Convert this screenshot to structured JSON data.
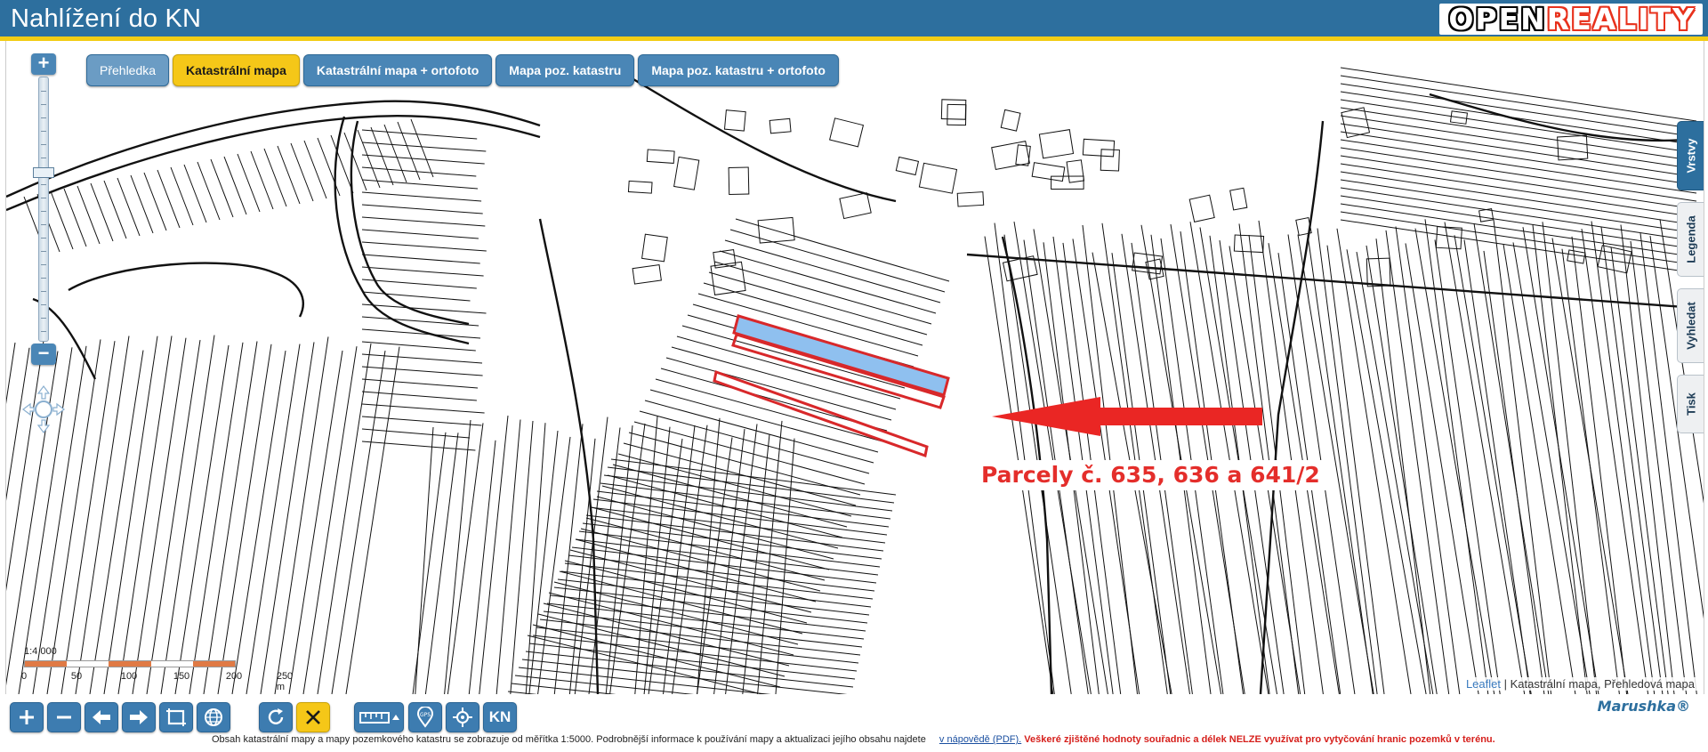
{
  "header": {
    "title": "Nahlížení do KN",
    "logo": {
      "open": "OPEN",
      "reality": "REALITY"
    }
  },
  "tabs": [
    {
      "label": "Přehledka",
      "state": "dim"
    },
    {
      "label": "Katastrální mapa",
      "state": "active"
    },
    {
      "label": "Katastrální mapa + ortofoto",
      "state": "normal"
    },
    {
      "label": "Mapa poz. katastru",
      "state": "normal"
    },
    {
      "label": "Mapa poz. katastru + ortofoto",
      "state": "normal"
    }
  ],
  "zoom": {
    "plus": "+",
    "minus": "−"
  },
  "side_tabs": [
    {
      "label": "Vrstvy",
      "active": true
    },
    {
      "label": "Legenda",
      "active": false
    },
    {
      "label": "Vyhledat",
      "active": false
    },
    {
      "label": "Tisk",
      "active": false
    }
  ],
  "scale": {
    "ratio": "1:4 000",
    "labels": [
      "0",
      "50",
      "100",
      "150",
      "200",
      "250 m"
    ],
    "colors": [
      "#e07a45",
      "#ffffff"
    ]
  },
  "annotation": {
    "label": "Parcely č. 635, 636 a 641/2",
    "color": "#e42e2b",
    "highlight_fill": "#8fc0ef"
  },
  "attribution": {
    "leaflet": "Leaflet",
    "separator": " | ",
    "text": "Katastrální mapa, Přehledová mapa"
  },
  "toolbar": {
    "buttons": [
      {
        "name": "zoom-in-button",
        "icon": "plus-icon"
      },
      {
        "name": "zoom-out-button",
        "icon": "minus-icon"
      },
      {
        "name": "back-button",
        "icon": "arrow-left-icon"
      },
      {
        "name": "forward-button",
        "icon": "arrow-right-icon"
      },
      {
        "name": "zoom-extent-button",
        "icon": "extent-icon"
      },
      {
        "name": "overview-button",
        "icon": "globe-icon"
      },
      {
        "name": "refresh-button",
        "icon": "refresh-icon"
      },
      {
        "name": "clear-button",
        "icon": "close-icon"
      },
      {
        "name": "measure-button",
        "icon": "ruler-icon"
      },
      {
        "name": "gps-button",
        "icon": "gps-pin-icon"
      },
      {
        "name": "locate-button",
        "icon": "crosshair-icon"
      },
      {
        "name": "kn-button",
        "icon": "kn-icon",
        "text": "KN"
      }
    ],
    "brand": "Marushka®",
    "notice": "Obsah katastrální mapy a mapy pozemkového katastru se zobrazuje od měřítka 1:5000. Podrobnější informace k používání mapy a aktualizaci jejího obsahu najdete",
    "notice_link": "v nápovědě (PDF).",
    "notice_warning": "Veškeré zjištěné hodnoty souřadnic a délek NELZE využívat pro vytyčování hranic pozemků v terénu."
  }
}
